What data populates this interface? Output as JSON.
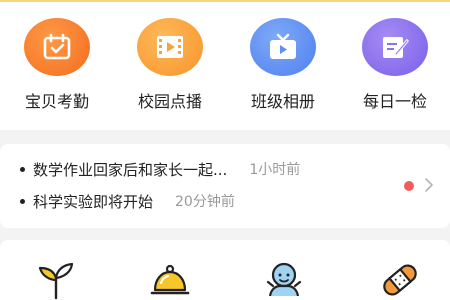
{
  "quick_actions": [
    {
      "label": "宝贝考勤",
      "icon": "calendar-check-icon",
      "color": "#f6842c"
    },
    {
      "label": "校园点播",
      "icon": "video-film-icon",
      "color": "#f9a33a"
    },
    {
      "label": "班级相册",
      "icon": "tv-icon",
      "color": "#5f8ff3"
    },
    {
      "label": "每日一检",
      "icon": "note-edit-icon",
      "color": "#8d73ee"
    }
  ],
  "news": [
    {
      "text": "数学作业回家后和家长一起...",
      "time": "1小时前"
    },
    {
      "text": "科学实验即将开始",
      "time": "20分钟前"
    }
  ],
  "tools": [
    {
      "icon": "sprout-icon"
    },
    {
      "icon": "food-cloche-icon"
    },
    {
      "icon": "kid-icon"
    },
    {
      "icon": "bandage-icon"
    }
  ],
  "colors": {
    "accent_yellow": "#f6c62b",
    "unread_red": "#f25b5b",
    "text": "#222222",
    "muted": "#9a9a9a"
  }
}
